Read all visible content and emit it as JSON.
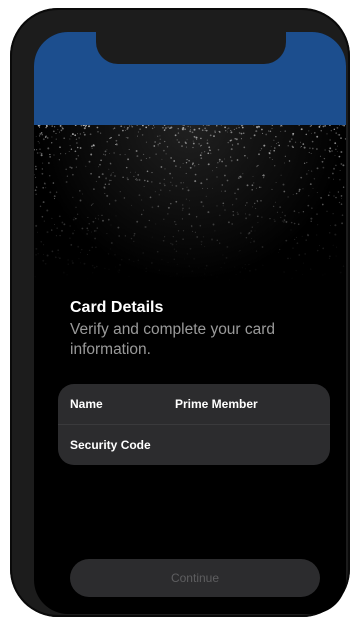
{
  "card_details": {
    "title": "Card Details",
    "subtitle": "Verify and complete your card information."
  },
  "fields": [
    {
      "label": "Name",
      "value": "Prime Member"
    },
    {
      "label": "Security Code",
      "value": ""
    }
  ],
  "continue_label": "Continue",
  "colors": {
    "status_bar": "#1c4e8e",
    "screen_bg": "#000000",
    "card_bg": "#2c2c2e",
    "button_bg": "#2c2c2e",
    "button_text_disabled": "#5e5e60",
    "subtitle_text": "#9a9a9a"
  }
}
